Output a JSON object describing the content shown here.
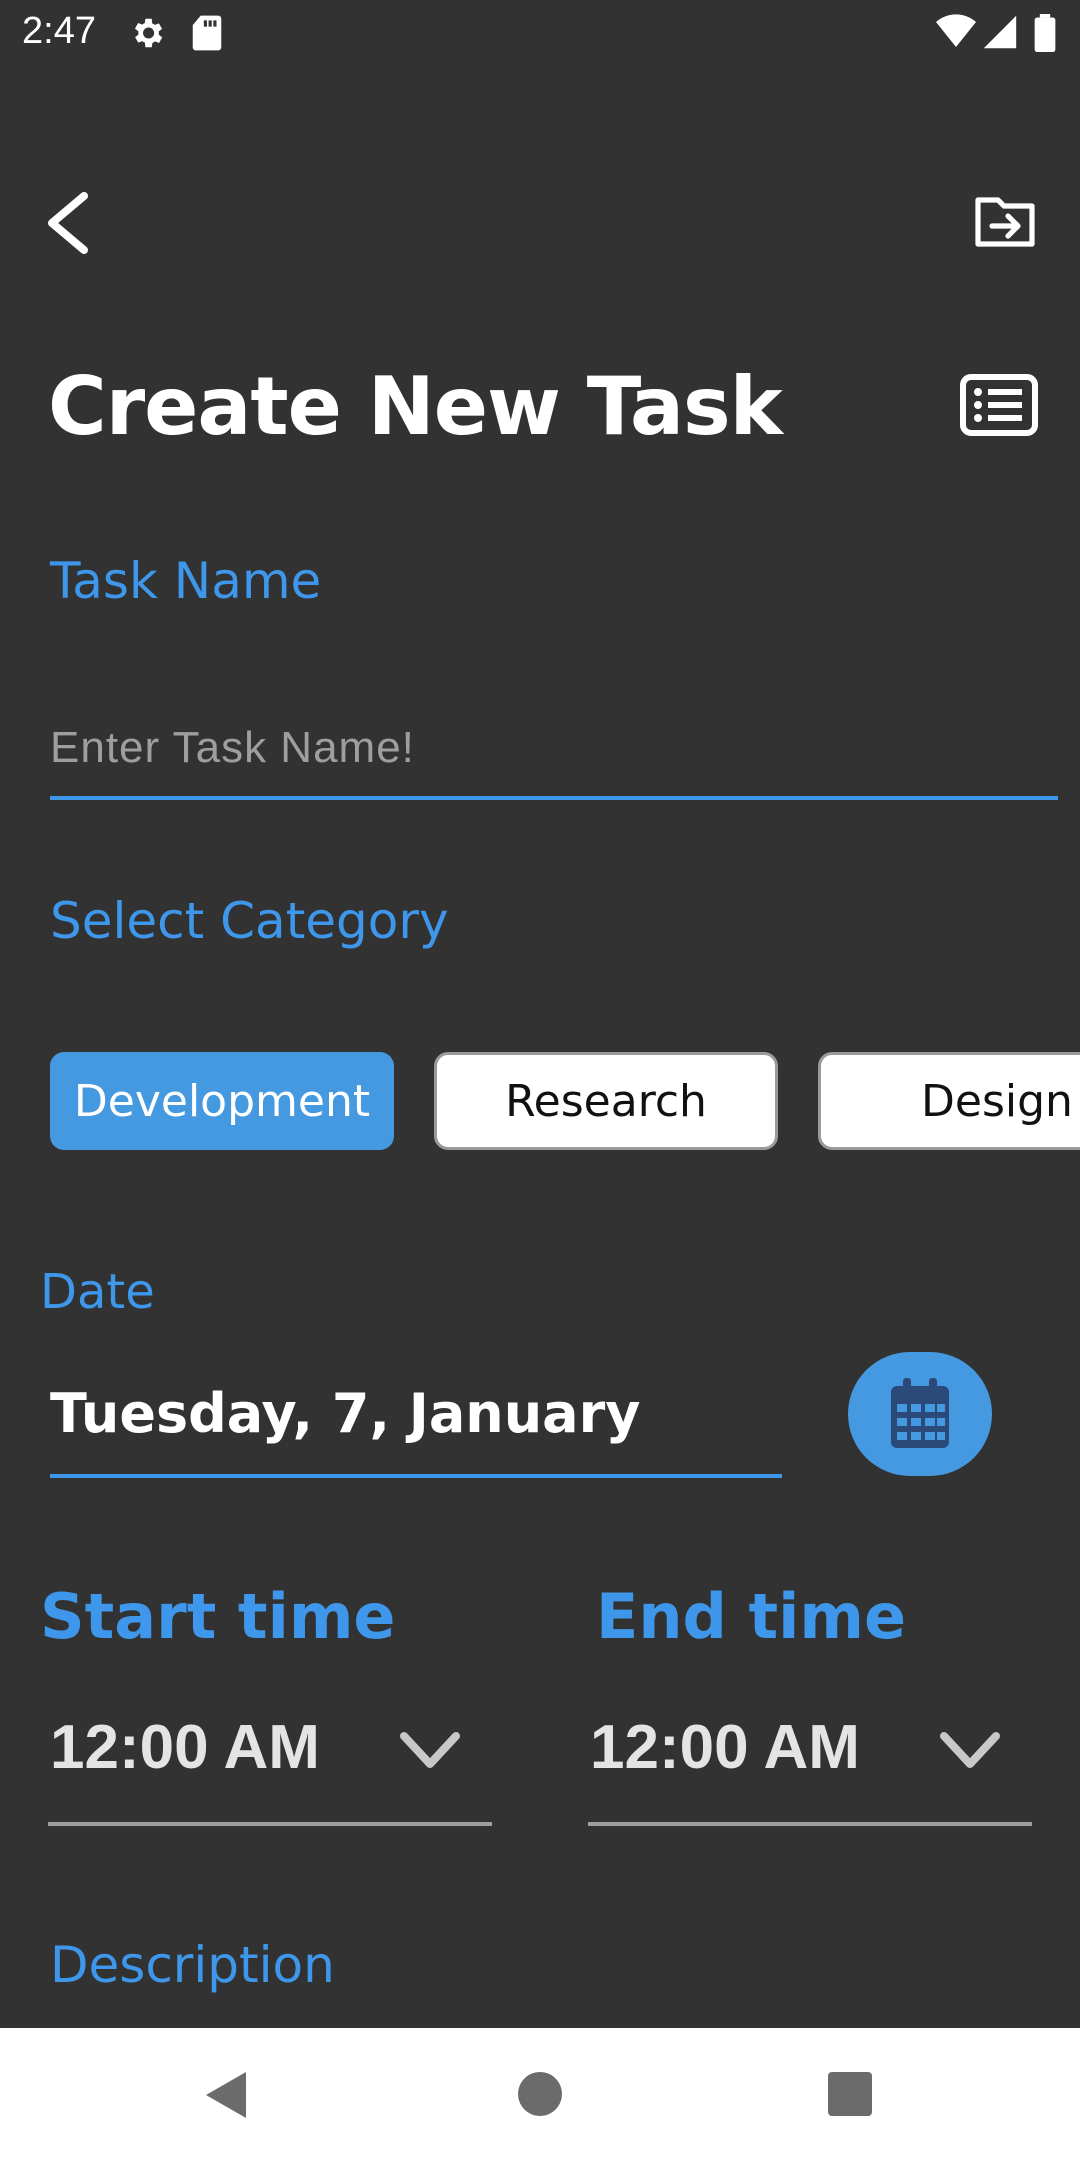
{
  "status_bar": {
    "time": "2:47",
    "icons": [
      "gear-icon",
      "sd-card-icon",
      "wifi-icon",
      "signal-icon",
      "battery-icon"
    ]
  },
  "app_bar": {
    "back_icon": "chevron-left-icon",
    "action_icon": "folder-move-icon"
  },
  "header": {
    "title": "Create New Task",
    "list_icon": "list-view-icon"
  },
  "task_name": {
    "label": "Task Name",
    "placeholder": "Enter Task Name!",
    "value": ""
  },
  "category": {
    "label": "Select Category",
    "options": [
      {
        "label": "Development",
        "selected": true
      },
      {
        "label": "Research",
        "selected": false
      },
      {
        "label": "Design",
        "selected": false
      }
    ]
  },
  "date": {
    "label": "Date",
    "value": "Tuesday, 7, January",
    "calendar_icon": "calendar-icon"
  },
  "start_time": {
    "label": "Start time",
    "value": "12:00 AM"
  },
  "end_time": {
    "label": "End time",
    "value": "12:00 AM"
  },
  "description": {
    "label": "Description"
  },
  "colors": {
    "background": "#323232",
    "accent": "#3e97ea",
    "chip_active": "#4599e0",
    "nav_bar": "#ffffff"
  }
}
